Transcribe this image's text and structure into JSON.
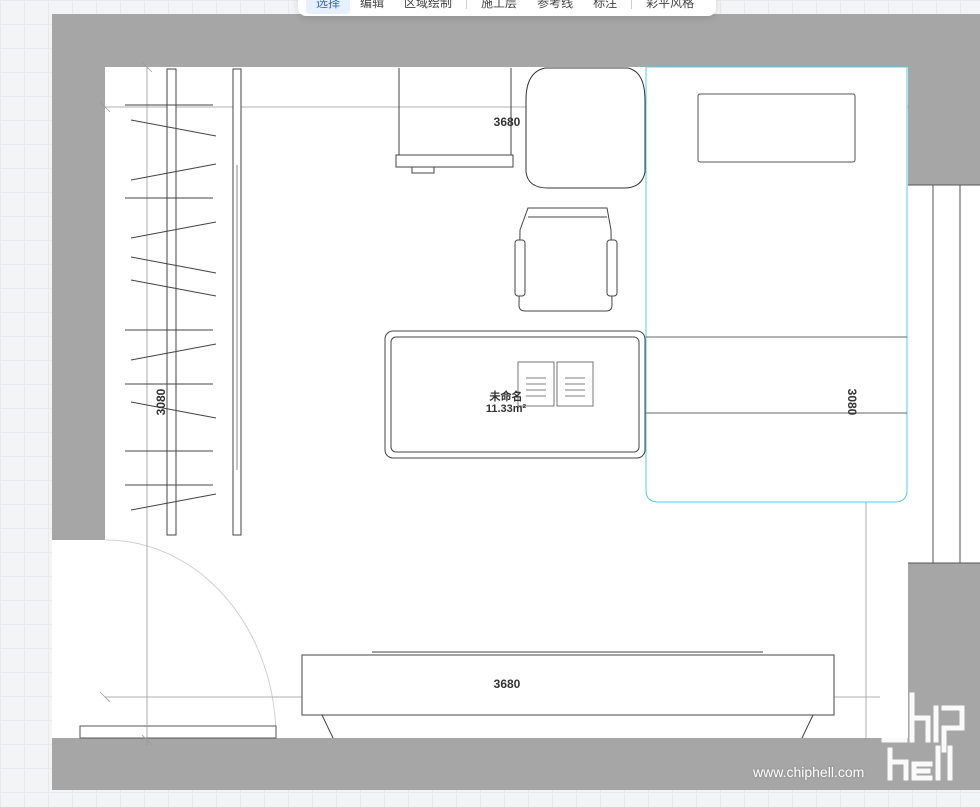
{
  "toolbar": {
    "items": [
      "选择",
      "编辑",
      "区域绘制",
      "施工层",
      "参考线",
      "标注",
      "彩平风格"
    ],
    "active": "选择"
  },
  "dimensions": {
    "top_width": "3680",
    "bottom_width": "3680",
    "left_height": "3080",
    "right_height": "3080"
  },
  "room": {
    "name": "未命名",
    "area": "11.33m²"
  },
  "watermark": {
    "text": "www.chiphell.com",
    "logo": "chiphell-logo"
  },
  "colors": {
    "wall": "#a6a6a6",
    "floor": "#ffffff",
    "selection": "#5bc8e8",
    "line": "#333333"
  }
}
